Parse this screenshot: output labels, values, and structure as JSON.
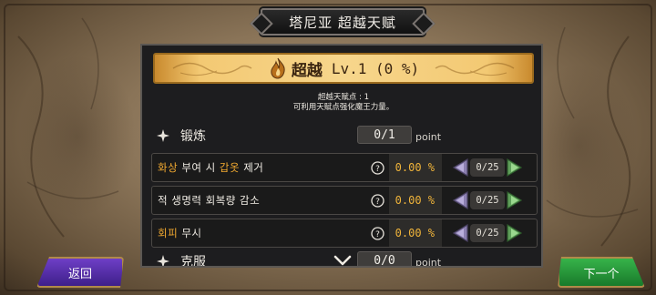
{
  "title": "塔尼亚  超越天赋",
  "banner": {
    "name": "超越",
    "level": "Lv.1 (0 %)"
  },
  "info": {
    "line1": "超越天赋点 : 1",
    "line2": "可利用天赋点强化魔王力量。"
  },
  "sections": [
    {
      "title": "锻炼",
      "points": "0/1",
      "point_unit": "point",
      "icon": "sparkle-icon",
      "talents": [
        {
          "name_parts": [
            [
              "화상",
              true
            ],
            [
              " 부여 시 ",
              false
            ],
            [
              "갑옷",
              true
            ],
            [
              " 제거",
              false
            ]
          ],
          "value": "0.00 %",
          "count": "0/25"
        },
        {
          "name_parts": [
            [
              "적 생명력 회복량 감소",
              false
            ]
          ],
          "value": "0.00 %",
          "count": "0/25"
        },
        {
          "name_parts": [
            [
              "회피",
              true
            ],
            [
              " 무시",
              false
            ]
          ],
          "value": "0.00 %",
          "count": "0/25"
        }
      ]
    },
    {
      "title": "克服",
      "points": "0/0",
      "point_unit": "point",
      "icon": "sparkle-icon",
      "talents": []
    }
  ],
  "buttons": {
    "back": "返回",
    "next": "下一个"
  },
  "colors": {
    "highlight": "#f0a830",
    "value": "#f0b43a",
    "banner": "#f7d68c",
    "back_button": "#5a30ad",
    "next_button": "#2a9a3c"
  }
}
